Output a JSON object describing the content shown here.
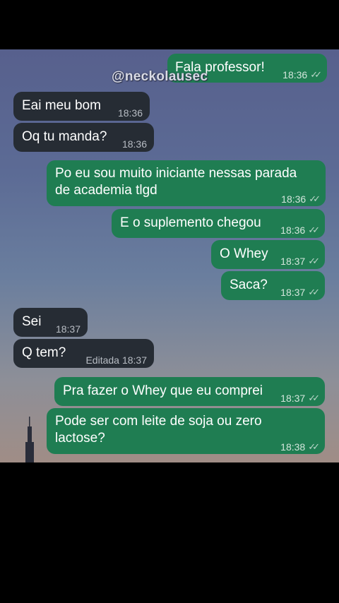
{
  "watermark": "@neckolausec",
  "messages": [
    {
      "text": "Fala professor!",
      "time": "18:36",
      "ticks": "✓✓"
    },
    {
      "text": "Eai meu bom",
      "time": "18:36"
    },
    {
      "text": "Oq tu manda?",
      "time": "18:36"
    },
    {
      "text_line1": "Po eu sou muito iniciante nessas parada",
      "text_line2": "de academia tlgd",
      "time": "18:36",
      "ticks": "✓✓"
    },
    {
      "text": "E o suplemento chegou",
      "time": "18:36",
      "ticks": "✓✓"
    },
    {
      "text": "O Whey",
      "time": "18:37",
      "ticks": "✓✓"
    },
    {
      "text": "Saca?",
      "time": "18:37",
      "ticks": "✓✓"
    },
    {
      "text": "Sei",
      "time": "18:37"
    },
    {
      "text": "Q tem?",
      "edited": "Editada",
      "time": "18:37"
    },
    {
      "text": "Pra fazer o Whey que eu comprei",
      "time": "18:37",
      "ticks": "✓✓"
    },
    {
      "text_line1": "Pode ser com leite de soja ou zero",
      "text_line2": "lactose?",
      "time": "18:38",
      "ticks": "✓✓"
    }
  ]
}
